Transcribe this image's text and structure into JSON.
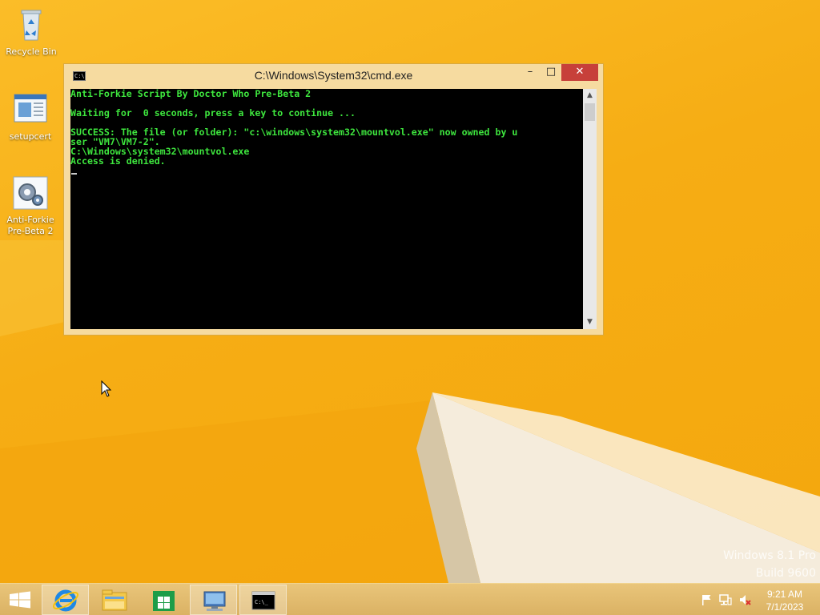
{
  "desktop": {
    "icons": [
      {
        "label": "Recycle Bin",
        "icon": "recycle-bin-icon"
      },
      {
        "label": "setupcert",
        "icon": "document-icon"
      },
      {
        "label": "Anti-Forkie Pre-Beta 2",
        "icon": "gears-script-icon"
      }
    ],
    "watermark": {
      "line1": "Windows 8.1 Pro",
      "line2": "Build 9600"
    }
  },
  "window": {
    "title": "C:\\Windows\\System32\\cmd.exe",
    "minimize_label": "–",
    "maximize_label": "□",
    "close_label": "✕",
    "console_lines": [
      "Anti-Forkie Script By Doctor Who Pre-Beta 2",
      "",
      "Waiting for  0 seconds, press a key to continue ...",
      "",
      "SUCCESS: The file (or folder): \"c:\\windows\\system32\\mountvol.exe\" now owned by u",
      "ser \"VM7\\VM7-2\".",
      "C:\\Windows\\system32\\mountvol.exe",
      "Access is denied."
    ]
  },
  "taskbar": {
    "items": [
      {
        "name": "start",
        "icon": "windows-logo-icon"
      },
      {
        "name": "internet-explorer",
        "icon": "internet-explorer-icon"
      },
      {
        "name": "file-explorer",
        "icon": "folder-icon"
      },
      {
        "name": "store",
        "icon": "store-icon"
      },
      {
        "name": "remote-desktop",
        "icon": "computer-icon"
      },
      {
        "name": "command-prompt",
        "icon": "cmd-icon"
      }
    ],
    "clock": {
      "time": "9:21 AM",
      "date": "7/1/2023"
    }
  },
  "colors": {
    "console_text": "#3ee63e",
    "close_button": "#c7403a",
    "wallpaper": "#f7b21a"
  }
}
